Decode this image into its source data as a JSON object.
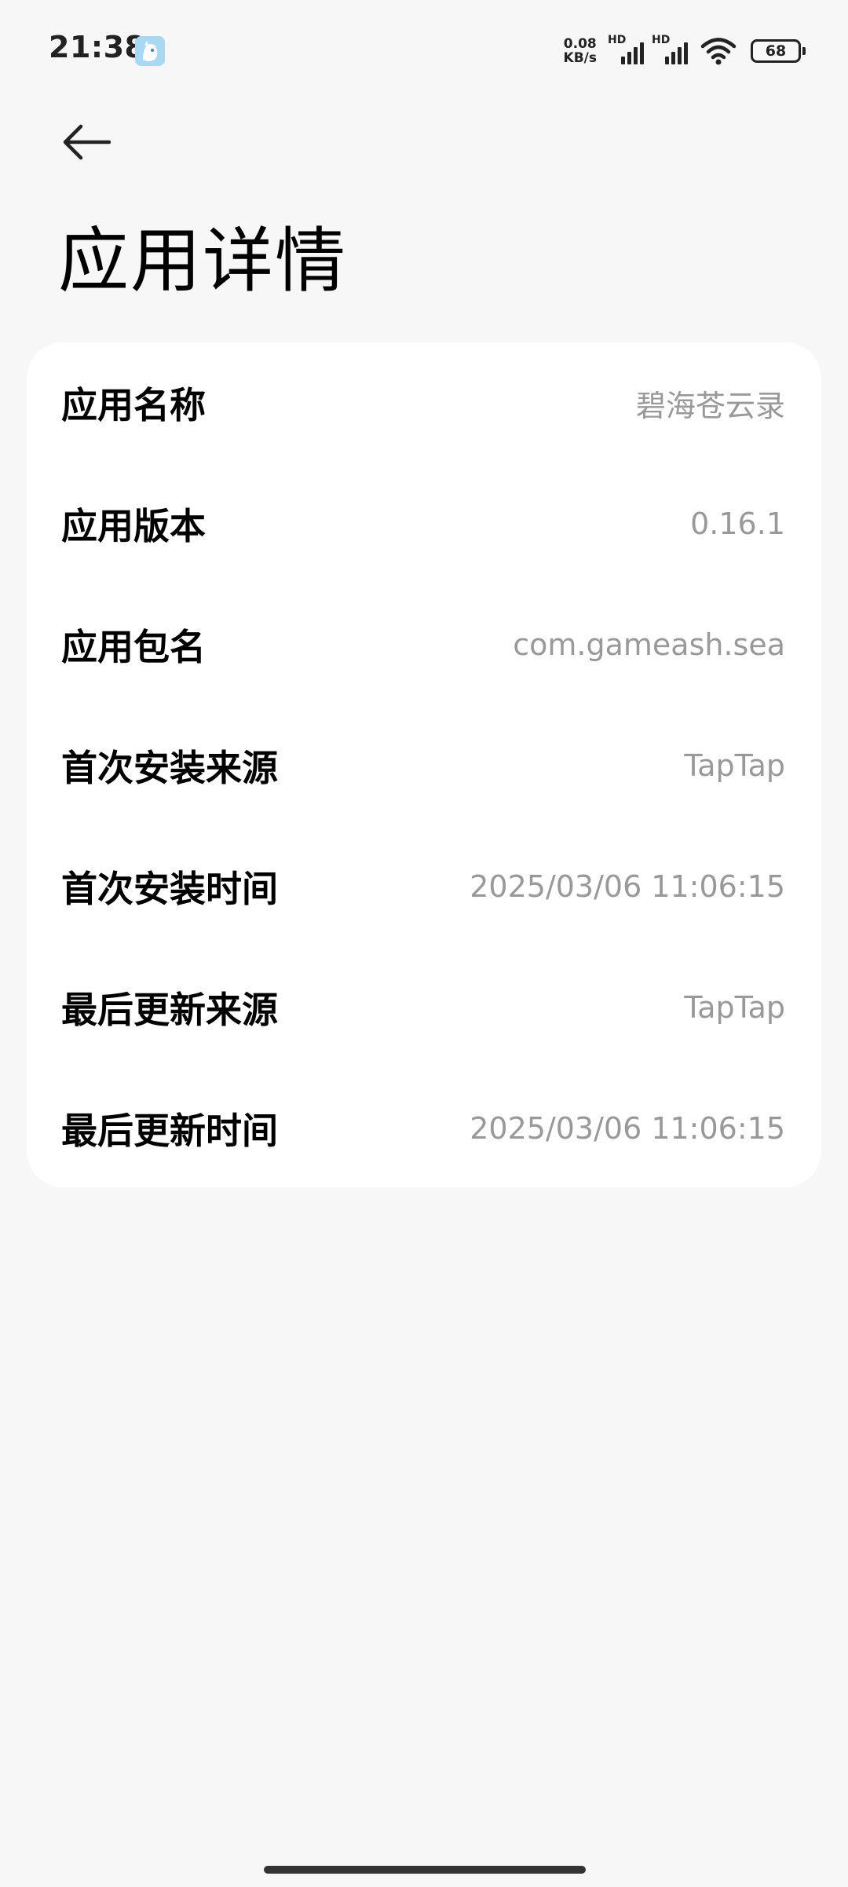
{
  "status_bar": {
    "time": "21:38",
    "net_speed_value": "0.08",
    "net_speed_unit": "KB/s",
    "signal1_label": "HD",
    "signal2_label": "HD",
    "battery_level": "68"
  },
  "header": {
    "title": "应用详情"
  },
  "details": [
    {
      "label": "应用名称",
      "value": "碧海苍云录"
    },
    {
      "label": "应用版本",
      "value": "0.16.1"
    },
    {
      "label": "应用包名",
      "value": "com.gameash.sea"
    },
    {
      "label": "首次安装来源",
      "value": "TapTap"
    },
    {
      "label": "首次安装时间",
      "value": "2025/03/06 11:06:15"
    },
    {
      "label": "最后更新来源",
      "value": "TapTap"
    },
    {
      "label": "最后更新时间",
      "value": "2025/03/06 11:06:15"
    }
  ],
  "colors": {
    "background": "#f7f7f7",
    "card": "#ffffff",
    "label": "#000000",
    "value": "#999999"
  }
}
